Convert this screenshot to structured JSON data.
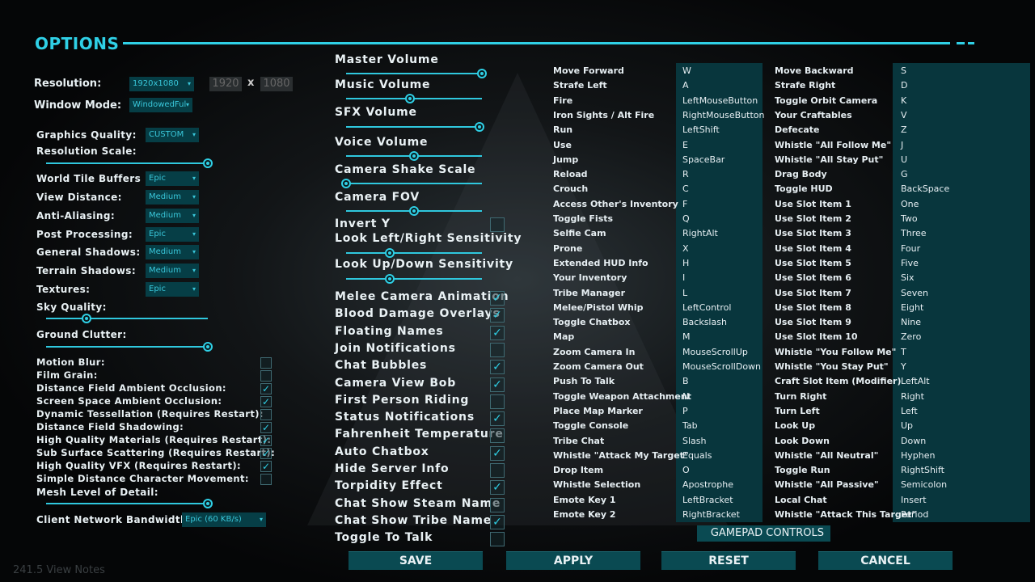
{
  "title": "OPTIONS",
  "resolution": {
    "label": "Resolution:",
    "value": "1920x1080",
    "width": "1920",
    "x": "x",
    "height": "1080"
  },
  "window_mode": {
    "label": "Window Mode:",
    "value": "WindowedFul"
  },
  "graphics": [
    {
      "label": "Graphics Quality:",
      "value": "CUSTOM"
    },
    {
      "label": "World Tile Buffers",
      "value": "Epic"
    },
    {
      "label": "View Distance:",
      "value": "Medium"
    },
    {
      "label": "Anti-Aliasing:",
      "value": "Medium"
    },
    {
      "label": "Post Processing:",
      "value": "Epic"
    },
    {
      "label": "General Shadows:",
      "value": "Medium"
    },
    {
      "label": "Terrain Shadows:",
      "value": "Medium"
    },
    {
      "label": "Textures:",
      "value": "Epic"
    }
  ],
  "left_sliders": [
    {
      "label": "Resolution Scale:",
      "value": 1.0
    },
    {
      "label": "Sky Quality:",
      "value": 0.25
    },
    {
      "label": "Ground Clutter:",
      "value": 1.0
    },
    {
      "label": "Mesh Level of Detail:",
      "value": 1.0
    }
  ],
  "left_checks": [
    {
      "label": "Motion Blur:",
      "checked": false
    },
    {
      "label": "Film Grain:",
      "checked": false
    },
    {
      "label": "Distance Field Ambient Occlusion:",
      "checked": true
    },
    {
      "label": "Screen Space Ambient Occlusion:",
      "checked": true
    },
    {
      "label": "Dynamic Tessellation (Requires Restart):",
      "checked": false
    },
    {
      "label": "Distance Field Shadowing:",
      "checked": true
    },
    {
      "label": "High Quality Materials (Requires Restart):",
      "checked": true
    },
    {
      "label": "Sub Surface Scattering (Requires Restart):",
      "checked": true
    },
    {
      "label": "High Quality VFX (Requires Restart):",
      "checked": true
    },
    {
      "label": "Simple Distance Character Movement:",
      "checked": false
    }
  ],
  "bandwidth": {
    "label": "Client Network Bandwidth:",
    "value": "Epic (60 KB/s)"
  },
  "mid_sliders": [
    {
      "label": "Master Volume",
      "value": 1.0
    },
    {
      "label": "Music Volume",
      "value": 0.47
    },
    {
      "label": "SFX Volume",
      "value": 0.98
    },
    {
      "label": "Voice Volume",
      "value": 0.5
    },
    {
      "label": "Camera Shake Scale",
      "value": 0.0
    },
    {
      "label": "Camera FOV",
      "value": 0.5
    }
  ],
  "invert_y": {
    "label": "Invert Y",
    "checked": false
  },
  "sens_sliders": [
    {
      "label": "Look Left/Right Sensitivity",
      "value": 0.32
    },
    {
      "label": "Look Up/Down Sensitivity",
      "value": 0.32
    }
  ],
  "mid_checks": [
    {
      "label": "Melee Camera Animation",
      "checked": true
    },
    {
      "label": "Blood Damage Overlays",
      "checked": true
    },
    {
      "label": "Floating Names",
      "checked": true
    },
    {
      "label": "Join Notifications",
      "checked": false
    },
    {
      "label": "Chat Bubbles",
      "checked": true
    },
    {
      "label": "Camera View Bob",
      "checked": true
    },
    {
      "label": "First Person Riding",
      "checked": false
    },
    {
      "label": "Status Notifications",
      "checked": true
    },
    {
      "label": "Fahrenheit Temperature",
      "checked": false
    },
    {
      "label": "Auto Chatbox",
      "checked": true
    },
    {
      "label": "Hide Server Info",
      "checked": false
    },
    {
      "label": "Torpidity Effect",
      "checked": true
    },
    {
      "label": "Chat Show Steam Name",
      "checked": false
    },
    {
      "label": "Chat Show Tribe Name",
      "checked": true
    },
    {
      "label": "Toggle To Talk",
      "checked": false
    }
  ],
  "bindings_left": [
    [
      "Move Forward",
      "W"
    ],
    [
      "Strafe Left",
      "A"
    ],
    [
      "Fire",
      "LeftMouseButton"
    ],
    [
      "Iron Sights / Alt Fire",
      "RightMouseButton"
    ],
    [
      "Run",
      "LeftShift"
    ],
    [
      "Use",
      "E"
    ],
    [
      "Jump",
      "SpaceBar"
    ],
    [
      "Reload",
      "R"
    ],
    [
      "Crouch",
      "C"
    ],
    [
      "Access Other's Inventory",
      "F"
    ],
    [
      "Toggle Fists",
      "Q"
    ],
    [
      "Selfie Cam",
      "RightAlt"
    ],
    [
      "Prone",
      "X"
    ],
    [
      "Extended HUD Info",
      "H"
    ],
    [
      "Your Inventory",
      "I"
    ],
    [
      "Tribe Manager",
      "L"
    ],
    [
      "Melee/Pistol Whip",
      "LeftControl"
    ],
    [
      "Toggle Chatbox",
      "Backslash"
    ],
    [
      "Map",
      "M"
    ],
    [
      "Zoom Camera In",
      "MouseScrollUp"
    ],
    [
      "Zoom Camera Out",
      "MouseScrollDown"
    ],
    [
      "Push To Talk",
      "B"
    ],
    [
      "Toggle Weapon Attachment",
      "N"
    ],
    [
      "Place Map Marker",
      "P"
    ],
    [
      "Toggle Console",
      "Tab"
    ],
    [
      "Tribe Chat",
      "Slash"
    ],
    [
      "Whistle \"Attack My Target\"",
      "Equals"
    ],
    [
      "Drop Item",
      "O"
    ],
    [
      "Whistle Selection",
      "Apostrophe"
    ],
    [
      "Emote Key 1",
      "LeftBracket"
    ],
    [
      "Emote Key 2",
      "RightBracket"
    ]
  ],
  "bindings_right": [
    [
      "Move Backward",
      "S"
    ],
    [
      "Strafe Right",
      "D"
    ],
    [
      "Toggle Orbit Camera",
      "K"
    ],
    [
      "Your Craftables",
      "V"
    ],
    [
      "Defecate",
      "Z"
    ],
    [
      "Whistle \"All Follow Me\"",
      "J"
    ],
    [
      "Whistle \"All Stay Put\"",
      "U"
    ],
    [
      "Drag Body",
      "G"
    ],
    [
      "Toggle HUD",
      "BackSpace"
    ],
    [
      "Use Slot Item 1",
      "One"
    ],
    [
      "Use Slot Item 2",
      "Two"
    ],
    [
      "Use Slot Item 3",
      "Three"
    ],
    [
      "Use Slot Item 4",
      "Four"
    ],
    [
      "Use Slot Item 5",
      "Five"
    ],
    [
      "Use Slot Item 6",
      "Six"
    ],
    [
      "Use Slot Item 7",
      "Seven"
    ],
    [
      "Use Slot Item 8",
      "Eight"
    ],
    [
      "Use Slot Item 9",
      "Nine"
    ],
    [
      "Use Slot Item 10",
      "Zero"
    ],
    [
      "Whistle \"You Follow Me\"",
      "T"
    ],
    [
      "Whistle \"You Stay Put\"",
      "Y"
    ],
    [
      "Craft Slot Item (Modifier)",
      "LeftAlt"
    ],
    [
      "Turn Right",
      "Right"
    ],
    [
      "Turn Left",
      "Left"
    ],
    [
      "Look Up",
      "Up"
    ],
    [
      "Look Down",
      "Down"
    ],
    [
      "Whistle \"All Neutral\"",
      "Hyphen"
    ],
    [
      "Toggle Run",
      "RightShift"
    ],
    [
      "Whistle \"All Passive\"",
      "Semicolon"
    ],
    [
      "Local Chat",
      "Insert"
    ],
    [
      "Whistle \"Attack This Target\"",
      "Period"
    ]
  ],
  "gamepad_label": "GAMEPAD CONTROLS",
  "buttons": {
    "save": "SAVE",
    "apply": "APPLY",
    "reset": "RESET",
    "cancel": "CANCEL"
  },
  "version": "241.5 View Notes",
  "colors": {
    "accent": "#2fd0e6",
    "panel": "#0a4a52",
    "dropdown": "#063e46"
  }
}
